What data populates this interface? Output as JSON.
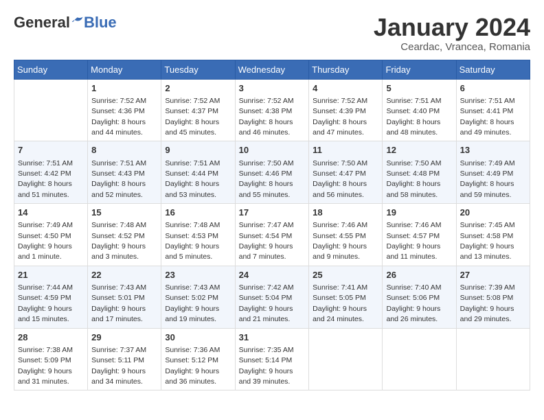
{
  "header": {
    "logo_general": "General",
    "logo_blue": "Blue",
    "month_title": "January 2024",
    "location": "Ceardac, Vrancea, Romania"
  },
  "days_of_week": [
    "Sunday",
    "Monday",
    "Tuesday",
    "Wednesday",
    "Thursday",
    "Friday",
    "Saturday"
  ],
  "weeks": [
    [
      {
        "day": "",
        "info": ""
      },
      {
        "day": "1",
        "info": "Sunrise: 7:52 AM\nSunset: 4:36 PM\nDaylight: 8 hours\nand 44 minutes."
      },
      {
        "day": "2",
        "info": "Sunrise: 7:52 AM\nSunset: 4:37 PM\nDaylight: 8 hours\nand 45 minutes."
      },
      {
        "day": "3",
        "info": "Sunrise: 7:52 AM\nSunset: 4:38 PM\nDaylight: 8 hours\nand 46 minutes."
      },
      {
        "day": "4",
        "info": "Sunrise: 7:52 AM\nSunset: 4:39 PM\nDaylight: 8 hours\nand 47 minutes."
      },
      {
        "day": "5",
        "info": "Sunrise: 7:51 AM\nSunset: 4:40 PM\nDaylight: 8 hours\nand 48 minutes."
      },
      {
        "day": "6",
        "info": "Sunrise: 7:51 AM\nSunset: 4:41 PM\nDaylight: 8 hours\nand 49 minutes."
      }
    ],
    [
      {
        "day": "7",
        "info": "Sunrise: 7:51 AM\nSunset: 4:42 PM\nDaylight: 8 hours\nand 51 minutes."
      },
      {
        "day": "8",
        "info": "Sunrise: 7:51 AM\nSunset: 4:43 PM\nDaylight: 8 hours\nand 52 minutes."
      },
      {
        "day": "9",
        "info": "Sunrise: 7:51 AM\nSunset: 4:44 PM\nDaylight: 8 hours\nand 53 minutes."
      },
      {
        "day": "10",
        "info": "Sunrise: 7:50 AM\nSunset: 4:46 PM\nDaylight: 8 hours\nand 55 minutes."
      },
      {
        "day": "11",
        "info": "Sunrise: 7:50 AM\nSunset: 4:47 PM\nDaylight: 8 hours\nand 56 minutes."
      },
      {
        "day": "12",
        "info": "Sunrise: 7:50 AM\nSunset: 4:48 PM\nDaylight: 8 hours\nand 58 minutes."
      },
      {
        "day": "13",
        "info": "Sunrise: 7:49 AM\nSunset: 4:49 PM\nDaylight: 8 hours\nand 59 minutes."
      }
    ],
    [
      {
        "day": "14",
        "info": "Sunrise: 7:49 AM\nSunset: 4:50 PM\nDaylight: 9 hours\nand 1 minute."
      },
      {
        "day": "15",
        "info": "Sunrise: 7:48 AM\nSunset: 4:52 PM\nDaylight: 9 hours\nand 3 minutes."
      },
      {
        "day": "16",
        "info": "Sunrise: 7:48 AM\nSunset: 4:53 PM\nDaylight: 9 hours\nand 5 minutes."
      },
      {
        "day": "17",
        "info": "Sunrise: 7:47 AM\nSunset: 4:54 PM\nDaylight: 9 hours\nand 7 minutes."
      },
      {
        "day": "18",
        "info": "Sunrise: 7:46 AM\nSunset: 4:55 PM\nDaylight: 9 hours\nand 9 minutes."
      },
      {
        "day": "19",
        "info": "Sunrise: 7:46 AM\nSunset: 4:57 PM\nDaylight: 9 hours\nand 11 minutes."
      },
      {
        "day": "20",
        "info": "Sunrise: 7:45 AM\nSunset: 4:58 PM\nDaylight: 9 hours\nand 13 minutes."
      }
    ],
    [
      {
        "day": "21",
        "info": "Sunrise: 7:44 AM\nSunset: 4:59 PM\nDaylight: 9 hours\nand 15 minutes."
      },
      {
        "day": "22",
        "info": "Sunrise: 7:43 AM\nSunset: 5:01 PM\nDaylight: 9 hours\nand 17 minutes."
      },
      {
        "day": "23",
        "info": "Sunrise: 7:43 AM\nSunset: 5:02 PM\nDaylight: 9 hours\nand 19 minutes."
      },
      {
        "day": "24",
        "info": "Sunrise: 7:42 AM\nSunset: 5:04 PM\nDaylight: 9 hours\nand 21 minutes."
      },
      {
        "day": "25",
        "info": "Sunrise: 7:41 AM\nSunset: 5:05 PM\nDaylight: 9 hours\nand 24 minutes."
      },
      {
        "day": "26",
        "info": "Sunrise: 7:40 AM\nSunset: 5:06 PM\nDaylight: 9 hours\nand 26 minutes."
      },
      {
        "day": "27",
        "info": "Sunrise: 7:39 AM\nSunset: 5:08 PM\nDaylight: 9 hours\nand 29 minutes."
      }
    ],
    [
      {
        "day": "28",
        "info": "Sunrise: 7:38 AM\nSunset: 5:09 PM\nDaylight: 9 hours\nand 31 minutes."
      },
      {
        "day": "29",
        "info": "Sunrise: 7:37 AM\nSunset: 5:11 PM\nDaylight: 9 hours\nand 34 minutes."
      },
      {
        "day": "30",
        "info": "Sunrise: 7:36 AM\nSunset: 5:12 PM\nDaylight: 9 hours\nand 36 minutes."
      },
      {
        "day": "31",
        "info": "Sunrise: 7:35 AM\nSunset: 5:14 PM\nDaylight: 9 hours\nand 39 minutes."
      },
      {
        "day": "",
        "info": ""
      },
      {
        "day": "",
        "info": ""
      },
      {
        "day": "",
        "info": ""
      }
    ]
  ]
}
